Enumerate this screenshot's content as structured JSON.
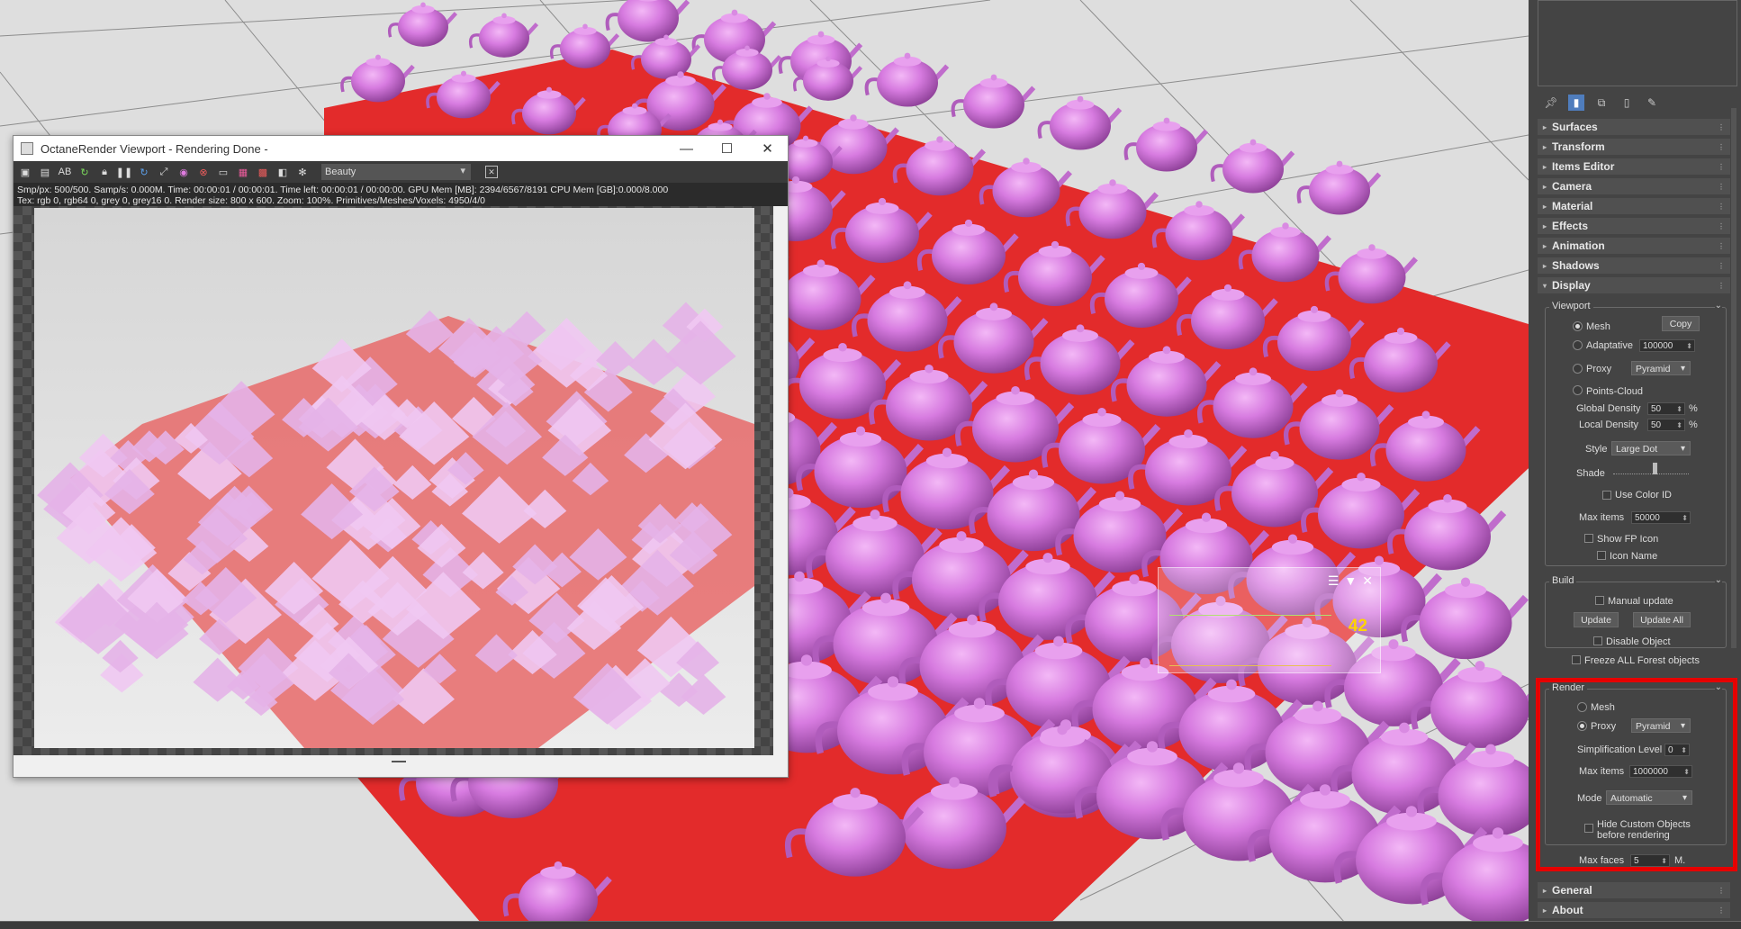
{
  "scene": {
    "selection_count": "42"
  },
  "octane": {
    "title": "OctaneRender Viewport - Rendering Done -",
    "pass_select": "Beauty",
    "toolbar_icons": [
      "save-icon",
      "copy-icon",
      "ab-icon",
      "refresh-icon",
      "lock-icon",
      "pause-icon",
      "restart-icon",
      "camera-icon",
      "color-icon",
      "region-icon",
      "display-icon",
      "film-icon",
      "material-icon",
      "texture-icon",
      "settings-icon"
    ],
    "info_line1": "Smp/px: 500/500.   Samp/s: 0.000M.   Time: 00:00:01 / 00:00:01.   Time left: 00:00:01 / 00:00:00.   GPU Mem [MB]: 2394/6567/8191   CPU Mem [GB]:0.000/8.000",
    "info_line2": "Tex: rgb 0, rgb64 0, grey 0, grey16 0.   Render size: 800 x 600.   Zoom: 100%.   Primitives/Meshes/Voxels: 4950/4/0"
  },
  "panel": {
    "rollouts_top": [
      "Surfaces",
      "Transform",
      "Items Editor",
      "Camera",
      "Material",
      "Effects",
      "Animation",
      "Shadows",
      "Display"
    ],
    "viewport": {
      "title": "Viewport",
      "mesh": "Mesh",
      "copy": "Copy",
      "adaptive": "Adaptative",
      "adaptive_value": "100000",
      "proxy": "Proxy",
      "proxy_type": "Pyramid",
      "points_cloud": "Points-Cloud",
      "global_density": "Global Density",
      "global_density_value": "50",
      "local_density": "Local Density",
      "local_density_value": "50",
      "pct": "%",
      "style": "Style",
      "style_value": "Large Dot",
      "shade": "Shade",
      "use_color_id": "Use Color ID",
      "max_items": "Max items",
      "max_items_value": "50000",
      "show_fp_icon": "Show FP Icon",
      "icon_name": "Icon Name"
    },
    "build": {
      "title": "Build",
      "manual_update": "Manual update",
      "update": "Update",
      "update_all": "Update All",
      "disable_object": "Disable Object",
      "freeze_all": "Freeze ALL Forest objects"
    },
    "render": {
      "title": "Render",
      "mesh": "Mesh",
      "proxy": "Proxy",
      "proxy_type": "Pyramid",
      "simplification": "Simplification Level",
      "simplification_value": "0",
      "max_items": "Max items",
      "max_items_value": "1000000",
      "mode": "Mode",
      "mode_value": "Automatic",
      "hide_custom_1": "Hide Custom Objects",
      "hide_custom_2": "before rendering",
      "max_faces": "Max faces",
      "max_faces_value": "5",
      "max_faces_unit": "M."
    },
    "rollouts_bottom": [
      "General",
      "About"
    ]
  }
}
